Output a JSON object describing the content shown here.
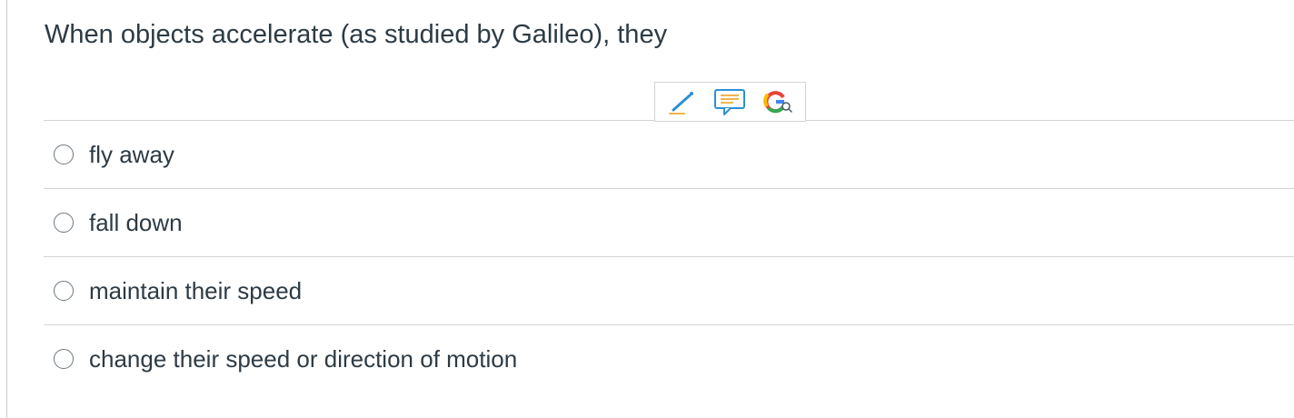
{
  "question": {
    "text": "When objects accelerate (as studied by Galileo), they"
  },
  "toolbar": {
    "icons": [
      "pencil-icon",
      "comment-icon",
      "google-search-icon"
    ]
  },
  "answers": [
    {
      "label": "fly away",
      "selected": false
    },
    {
      "label": "fall down",
      "selected": false
    },
    {
      "label": "maintain their speed",
      "selected": false
    },
    {
      "label": "change their speed or direction of motion",
      "selected": false
    }
  ]
}
